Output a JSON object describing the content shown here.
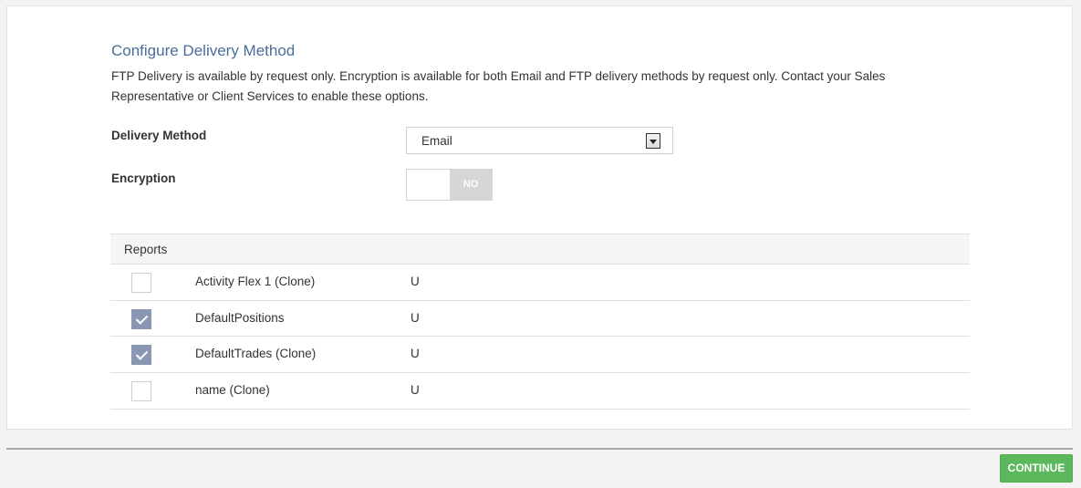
{
  "section": {
    "title": "Configure Delivery Method",
    "description": "FTP Delivery is available by request only. Encryption is available for both Email and FTP delivery methods by request only. Contact your Sales Representative or Client Services to enable these options."
  },
  "delivery_method": {
    "label": "Delivery Method",
    "selected": "Email"
  },
  "encryption": {
    "label": "Encryption",
    "state_label": "NO",
    "enabled": false
  },
  "reports": {
    "header": "Reports",
    "rows": [
      {
        "name": "Activity Flex 1 (Clone)",
        "code": "U",
        "checked": false
      },
      {
        "name": "DefaultPositions",
        "code": "U",
        "checked": true
      },
      {
        "name": "DefaultTrades (Clone)",
        "code": "U",
        "checked": true
      },
      {
        "name": "name (Clone)",
        "code": "U",
        "checked": false
      }
    ]
  },
  "footer": {
    "continue_label": "CONTINUE"
  },
  "colors": {
    "title": "#4a6d9a",
    "checkbox_checked": "#8a97b2",
    "continue_button": "#5cb85c"
  }
}
